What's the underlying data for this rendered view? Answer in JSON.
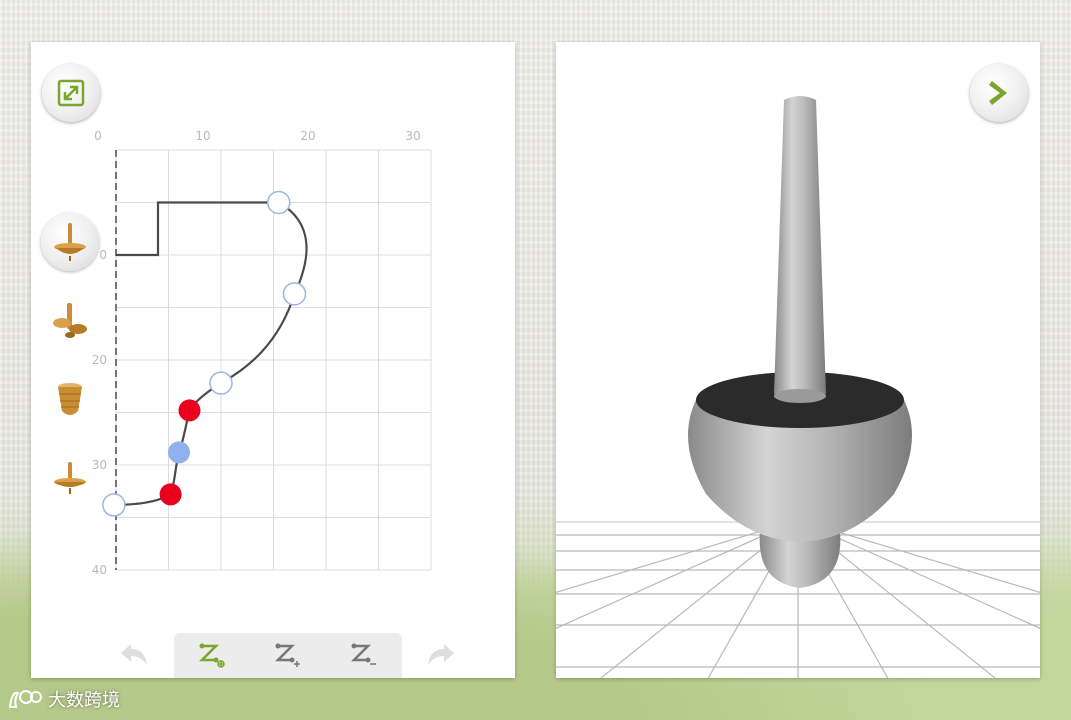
{
  "editor": {
    "x_axis_ticks": [
      "0",
      "10",
      "20",
      "30"
    ],
    "y_axis_ticks": [
      "0",
      "20",
      "30",
      "40"
    ],
    "y_tick_values": [
      10,
      20,
      30,
      40
    ],
    "profile_points": [
      {
        "x": 15.5,
        "y": 5,
        "state": "open"
      },
      {
        "x": 17,
        "y": 13.7,
        "state": "open"
      },
      {
        "x": 10,
        "y": 22.2,
        "state": "open"
      },
      {
        "x": 7,
        "y": 24.8,
        "state": "red"
      },
      {
        "x": 6,
        "y": 28.8,
        "state": "selected"
      },
      {
        "x": 5.2,
        "y": 32.8,
        "state": "red"
      },
      {
        "x": -0.2,
        "y": 33.8,
        "state": "open"
      }
    ],
    "colors": {
      "grid": "#dcdcdc",
      "curve": "#4a4a4a",
      "point_open_stroke": "#9db4e6",
      "point_red": "#e8001c",
      "point_selected": "#8fb1ee",
      "accent_green": "#7aa62b"
    }
  },
  "sidebar": {
    "items": [
      {
        "icon": "spinning-top-tall-icon",
        "selected": true
      },
      {
        "icon": "spinning-top-disc-icon",
        "selected": false
      },
      {
        "icon": "spinning-top-barrel-icon",
        "selected": false
      },
      {
        "icon": "spinning-top-flat-icon",
        "selected": false
      }
    ]
  },
  "toolbar": {
    "tools": [
      {
        "icon": "add-node-icon",
        "active": true
      },
      {
        "icon": "insert-node-icon",
        "active": false
      },
      {
        "icon": "remove-node-icon",
        "active": false
      }
    ]
  },
  "watermark": {
    "text": "大数跨境"
  }
}
